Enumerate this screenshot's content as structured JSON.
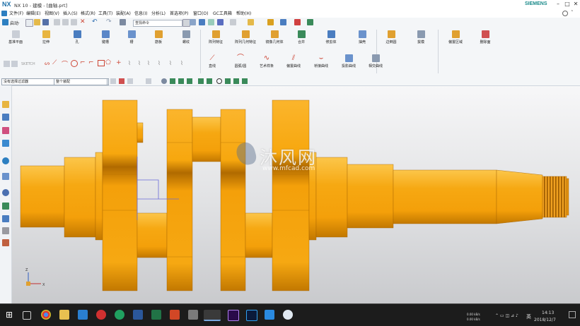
{
  "app": {
    "logo": "NX",
    "window_title": "NX 10 - 建模 - [曲轴.prt]",
    "brand": "SIEMENS",
    "window_controls": [
      "–",
      "□",
      "✕"
    ]
  },
  "menu": [
    "文件(F)",
    "编辑(E)",
    "视图(V)",
    "插入(S)",
    "格式(R)",
    "工具(T)",
    "装配(A)",
    "信息(I)",
    "分析(L)",
    "首选项(P)",
    "窗口(O)",
    "GC工具箱",
    "帮助(H)"
  ],
  "quick_toolbar": {
    "start_label": "启动·",
    "search_placeholder": "查找命令"
  },
  "ribbon": {
    "feature_buttons": [
      "基准平面",
      "拉伸",
      "孔",
      "键槽",
      "槽",
      "筋板",
      "螺纹",
      "阵列特征",
      "阵列几何特征",
      "镜像几何体",
      "合并",
      "修剪体",
      "抽壳",
      "边倒圆",
      "拔模",
      "偏置区域",
      "删除面"
    ],
    "curve_buttons": [
      "直线",
      "圆弧/圆",
      "艺术样条",
      "偏置曲线",
      "桥接曲线",
      "投影曲线",
      "相交曲线"
    ],
    "sketch_label": "SKETCH"
  },
  "selection_bar": {
    "filter": "没有选择过滤器",
    "scope": "整个装配"
  },
  "left_bar_icons": [
    "part-navigator",
    "assembly-navigator",
    "constraint-navigator",
    "reuse-library",
    "hd3d-tools",
    "web-browser",
    "history",
    "process-studio",
    "manufacturing-wizard",
    "role",
    "system-materials"
  ],
  "viewport": {
    "watermark_main": "沐风网",
    "watermark_url": "www.mfcad.com",
    "triad_labels": [
      "Z",
      "X"
    ]
  },
  "colors": {
    "part_base": "#f4a00a",
    "part_light": "#fcc64a",
    "part_dark": "#b06a00",
    "thread": "#c97a10",
    "sketch_line": "#6a6ad8",
    "ribbon_bg": "#f4f6f8",
    "taskbar_bg": "#1c1c1c"
  },
  "taskbar": {
    "apps": [
      "windows-start",
      "task-view",
      "chrome",
      "file-explorer",
      "app-blue",
      "netease-music",
      "app-green",
      "word",
      "excel",
      "powerpoint",
      "app-gray",
      "nx",
      "premiere",
      "photoshop",
      "app-blue-2",
      "baidu-netdisk"
    ],
    "net_up": "0.00 kB/s",
    "net_down": "0.00 kB/s",
    "ime": "英",
    "time": "14:13",
    "date": "2018/12/7"
  }
}
